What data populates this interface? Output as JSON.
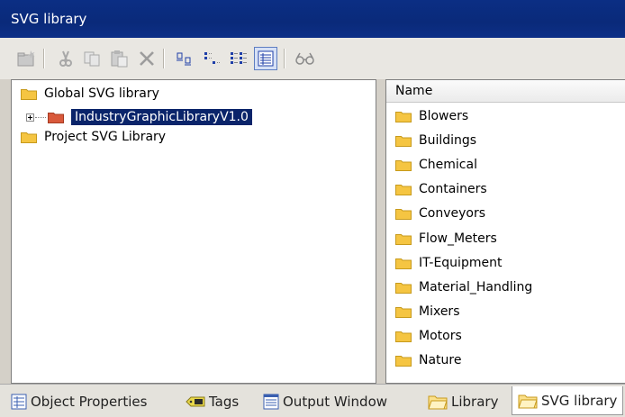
{
  "window": {
    "title": "SVG library"
  },
  "toolbar": {
    "buttons": [
      "new-folder-icon",
      "cut-icon",
      "copy-icon",
      "paste-icon",
      "delete-icon",
      "large-icons-view-icon",
      "small-icons-view-icon",
      "list-view-icon",
      "details-view-icon",
      "preview-icon"
    ],
    "active": "details-view-icon"
  },
  "tree": {
    "items": [
      {
        "label": "Global SVG library",
        "level": 0
      },
      {
        "label": "IndustryGraphicLibraryV1.0",
        "level": 1,
        "selected": true,
        "expandable": true
      },
      {
        "label": "Project SVG Library",
        "level": 0
      }
    ]
  },
  "list": {
    "column_header": "Name",
    "items": [
      "Blowers",
      "Buildings",
      "Chemical",
      "Containers",
      "Conveyors",
      "Flow_Meters",
      "IT-Equipment",
      "Material_Handling",
      "Mixers",
      "Motors",
      "Nature"
    ]
  },
  "tabs": [
    {
      "label": "Object Properties"
    },
    {
      "label": "Tags"
    },
    {
      "label": "Output Window"
    },
    {
      "label": "Library"
    },
    {
      "label": "SVG library",
      "active": true
    }
  ],
  "colors": {
    "title_bar": "#0a2a7a",
    "selection": "#0a246a",
    "folder": "#f5c542",
    "red_folder": "#d9593b"
  }
}
